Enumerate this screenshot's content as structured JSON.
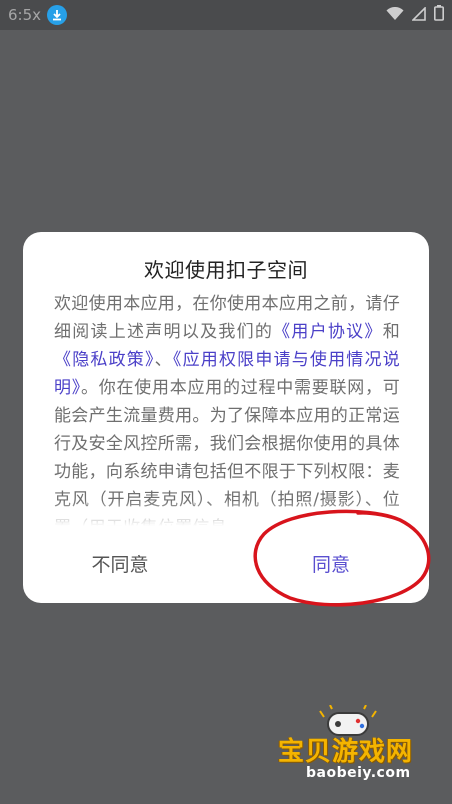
{
  "status_bar": {
    "time": "6:5x",
    "icons": [
      "download-icon",
      "wifi-icon",
      "signal-icon",
      "battery-icon"
    ],
    "download_color": "#27a0e8"
  },
  "dialog": {
    "title": "欢迎使用扣子空间",
    "body": {
      "part1": "欢迎使用本应用，在你使用本应用之前，请仔细阅读上述声明以及我们的",
      "link1": "《用户协议》",
      "part2": "和",
      "link2": "《隐私政策》",
      "part3": "、",
      "link3": "《应用权限申请与使用情况说明》",
      "part4": "。你在使用本应用的过程中需要联网，可能会产生流量费用。为了保障本应用的正常运行及安全风控所需，我们会根据你使用的具体功能，向系统申请包括但不限于下列权限：麦克风（开启麦克风）、相机（拍照/摄影）、位置（用于收集位置信息、"
    },
    "buttons": {
      "disagree": "不同意",
      "agree": "同意"
    },
    "link_color": "#4b40c8",
    "agree_color": "#5a4fd0"
  },
  "annotation": {
    "shape": "ellipse",
    "color": "#d8141c"
  },
  "watermark": {
    "title": "宝贝游戏网",
    "subtitle": "baobeiy.com"
  }
}
